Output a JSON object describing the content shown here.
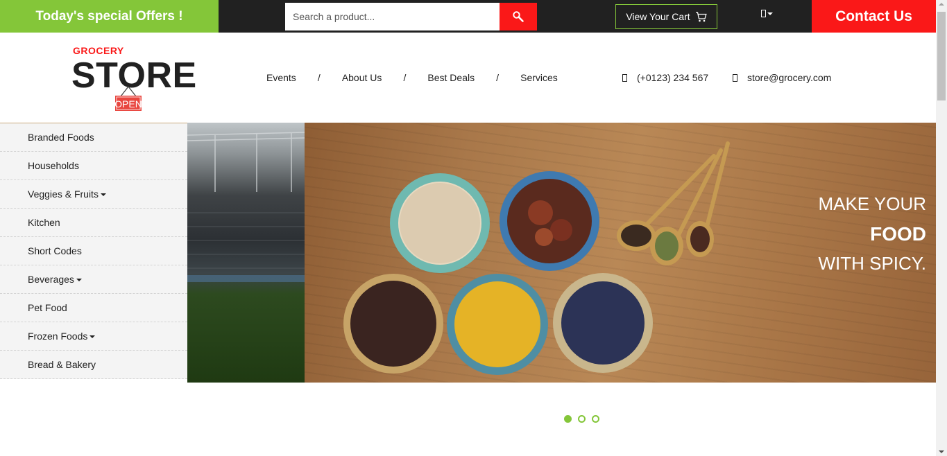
{
  "topbar": {
    "offer_text": "Today's special Offers !",
    "search": {
      "placeholder": "Search a product..."
    },
    "cart_label": "View Your Cart",
    "contact_label": "Contact Us"
  },
  "header": {
    "logo_small": "GROCERY",
    "logo_big": "STORE",
    "logo_sign": "OPEN",
    "nav": [
      {
        "label": "Events"
      },
      {
        "label": "About Us"
      },
      {
        "label": "Best Deals"
      },
      {
        "label": "Services"
      }
    ],
    "nav_separator": "/",
    "phone": "(+0123) 234 567",
    "email": "store@grocery.com"
  },
  "sidebar": {
    "items": [
      {
        "label": "Branded Foods",
        "dropdown": false
      },
      {
        "label": "Households",
        "dropdown": false
      },
      {
        "label": "Veggies & Fruits",
        "dropdown": true
      },
      {
        "label": "Kitchen",
        "dropdown": false
      },
      {
        "label": "Short Codes",
        "dropdown": false
      },
      {
        "label": "Beverages",
        "dropdown": true
      },
      {
        "label": "Pet Food",
        "dropdown": false
      },
      {
        "label": "Frozen Foods",
        "dropdown": true
      },
      {
        "label": "Bread & Bakery",
        "dropdown": false
      }
    ]
  },
  "banner": {
    "line1": "MAKE YOUR",
    "line2": "FOOD",
    "line3": "WITH SPICY."
  },
  "carousel": {
    "slide_count": 3,
    "active_index": 0
  },
  "colors": {
    "accent_green": "#84c639",
    "accent_red": "#fa1818",
    "dark": "#212121"
  },
  "icons": {
    "search": "search-icon",
    "cart": "cart-icon",
    "user": "user-icon",
    "phone": "phone-icon",
    "email": "envelope-icon"
  }
}
